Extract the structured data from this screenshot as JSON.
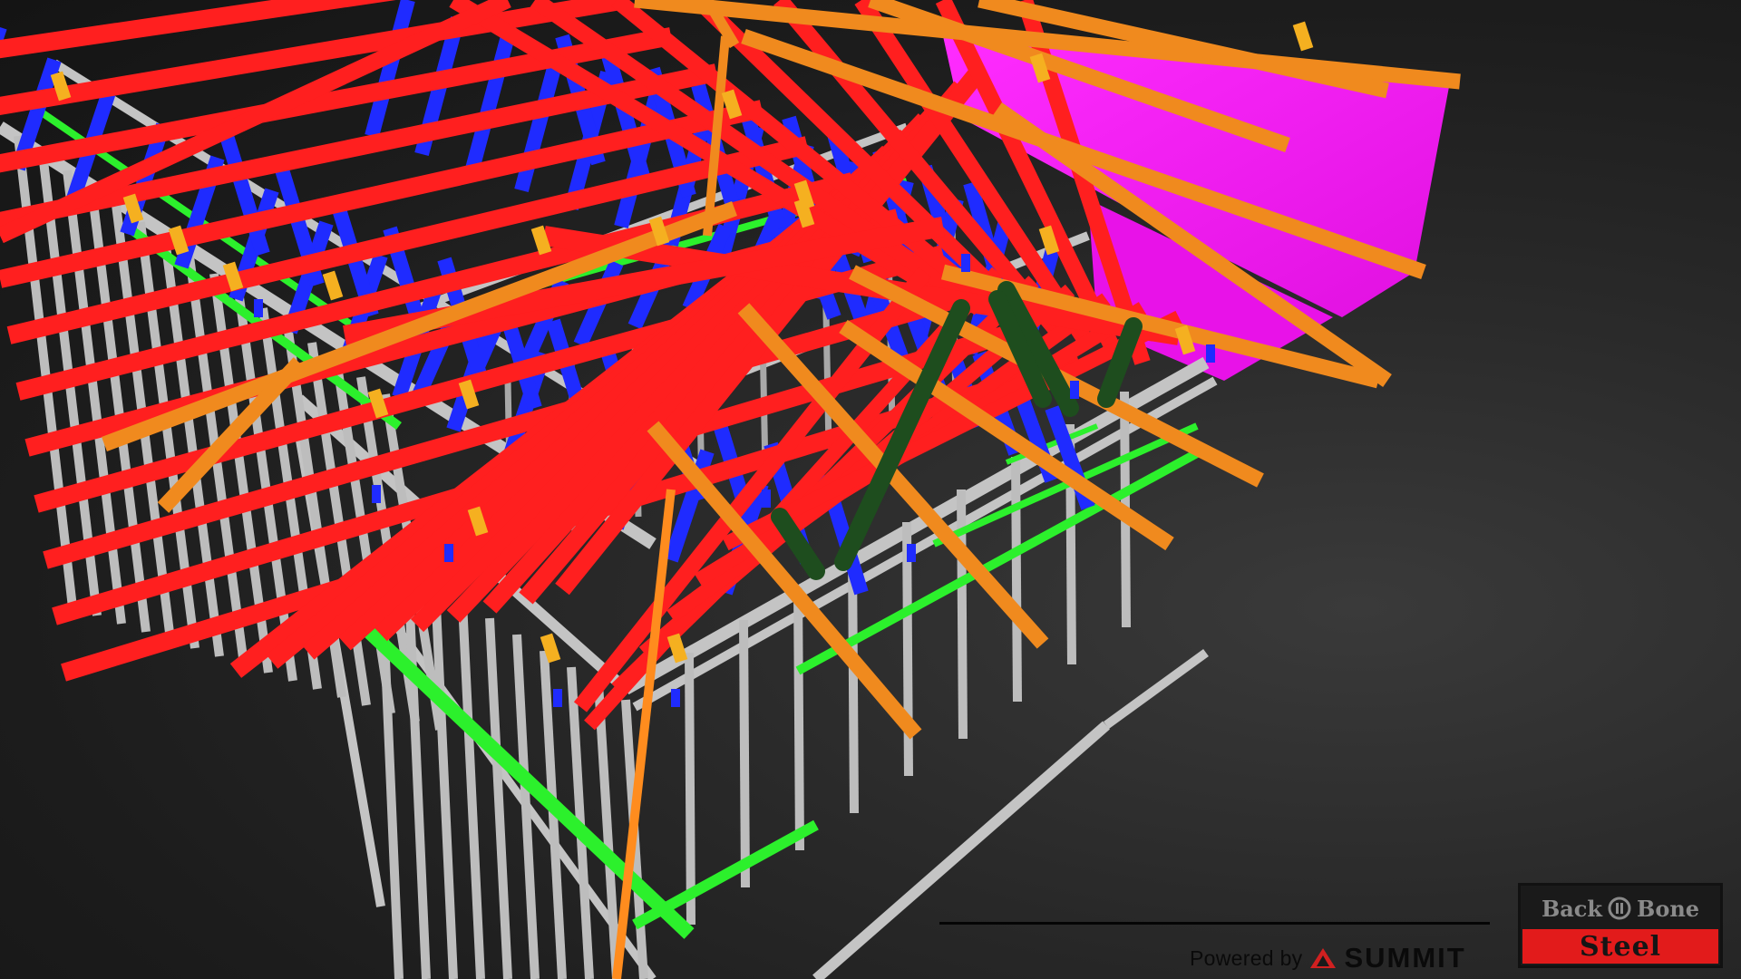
{
  "viewer": {
    "powered_by_label": "Powered by",
    "platform_name": "SUMMIT"
  },
  "brand": {
    "word_left": "Back",
    "word_right": "Bone",
    "word_bottom": "Steel",
    "accent_color": "#e21b1b"
  },
  "model_colors": {
    "truss_chord": "#ff1f1f",
    "truss_web": "#1f2bff",
    "rafter": "#f08a1e",
    "bracket": "#f5b020",
    "wall_frame": "#c8c8c8",
    "nogging": "#2cf02c",
    "hip_brace": "#1e4d1e",
    "sheeting": "#ff1fff"
  }
}
